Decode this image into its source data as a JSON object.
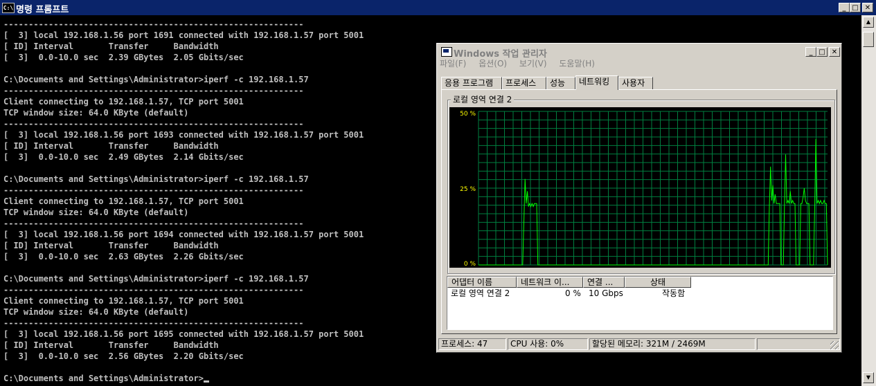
{
  "cmd": {
    "title": "명령 프롬프트",
    "icon_label": "C:\\",
    "lines": [
      "------------------------------------------------------------",
      "[  3] local 192.168.1.56 port 1691 connected with 192.168.1.57 port 5001",
      "[ ID] Interval       Transfer     Bandwidth",
      "[  3]  0.0-10.0 sec  2.39 GBytes  2.05 Gbits/sec",
      "",
      "C:\\Documents and Settings\\Administrator>iperf -c 192.168.1.57",
      "------------------------------------------------------------",
      "Client connecting to 192.168.1.57, TCP port 5001",
      "TCP window size: 64.0 KByte (default)",
      "------------------------------------------------------------",
      "[  3] local 192.168.1.56 port 1693 connected with 192.168.1.57 port 5001",
      "[ ID] Interval       Transfer     Bandwidth",
      "[  3]  0.0-10.0 sec  2.49 GBytes  2.14 Gbits/sec",
      "",
      "C:\\Documents and Settings\\Administrator>iperf -c 192.168.1.57",
      "------------------------------------------------------------",
      "Client connecting to 192.168.1.57, TCP port 5001",
      "TCP window size: 64.0 KByte (default)",
      "------------------------------------------------------------",
      "[  3] local 192.168.1.56 port 1694 connected with 192.168.1.57 port 5001",
      "[ ID] Interval       Transfer     Bandwidth",
      "[  3]  0.0-10.0 sec  2.63 GBytes  2.26 Gbits/sec",
      "",
      "C:\\Documents and Settings\\Administrator>iperf -c 192.168.1.57",
      "------------------------------------------------------------",
      "Client connecting to 192.168.1.57, TCP port 5001",
      "TCP window size: 64.0 KByte (default)",
      "------------------------------------------------------------",
      "[  3] local 192.168.1.56 port 1695 connected with 192.168.1.57 port 5001",
      "[ ID] Interval       Transfer     Bandwidth",
      "[  3]  0.0-10.0 sec  2.56 GBytes  2.20 Gbits/sec",
      "",
      "C:\\Documents and Settings\\Administrator>"
    ]
  },
  "taskmgr": {
    "title": "Windows 작업 관리자",
    "menu": [
      "파일(F)",
      "옵션(O)",
      "보기(V)",
      "도움말(H)"
    ],
    "tabs": [
      "응용 프로그램",
      "프로세스",
      "성능",
      "네트워킹",
      "사용자"
    ],
    "active_tab": "네트워킹",
    "graph_title": "로컬 영역 연결 2",
    "adapter_columns": [
      "어댑터 이름",
      "네트워크 이...",
      "연결 ...",
      "상태"
    ],
    "adapter_rows": [
      [
        "로컬 영역 연결 2",
        "0 %",
        "10 Gbps",
        "작동함"
      ]
    ],
    "status": {
      "processes": "프로세스: 47",
      "cpu": "CPU 사용: 0%",
      "memory": "할당된 메모리: 321M / 2469M"
    }
  },
  "chart_data": {
    "type": "line",
    "y_ticks": [
      "50 %",
      "25 %",
      "0 %"
    ],
    "ylim": [
      0,
      50
    ],
    "grid": true,
    "series": [
      {
        "color": "#00ff00",
        "values": [
          0,
          0,
          0,
          0,
          0,
          0,
          0,
          0,
          0,
          0,
          0,
          0,
          0,
          0,
          0,
          0,
          0,
          0,
          0,
          0,
          0,
          0,
          0,
          0,
          0,
          0,
          0,
          0,
          0,
          0,
          0,
          0,
          0,
          0,
          0,
          0,
          0,
          0,
          0,
          14,
          28,
          20,
          24,
          19,
          20,
          19,
          20,
          19,
          20,
          20,
          20,
          0,
          0,
          0,
          0,
          0,
          0,
          0,
          0,
          0,
          0,
          0,
          0,
          0,
          0,
          0,
          0,
          0,
          0,
          0,
          0,
          0,
          0,
          0,
          0,
          0,
          0,
          0,
          0,
          0,
          0,
          0,
          0,
          0,
          0,
          0,
          0,
          0,
          0,
          0,
          0,
          0,
          0,
          0,
          0,
          0,
          0,
          0,
          0,
          0,
          0,
          0,
          0,
          0,
          0,
          0,
          0,
          0,
          0,
          0,
          0,
          0,
          0,
          0,
          0,
          0,
          0,
          0,
          0,
          0,
          0,
          0,
          0,
          0,
          0,
          0,
          0,
          0,
          0,
          0,
          0,
          0,
          0,
          0,
          0,
          0,
          0,
          0,
          0,
          0,
          0,
          0,
          0,
          0,
          0,
          0,
          0,
          0,
          0,
          0,
          0,
          0,
          0,
          0,
          0,
          0,
          0,
          0,
          0,
          0,
          0,
          0,
          0,
          0,
          0,
          0,
          0,
          0,
          0,
          0,
          0,
          0,
          0,
          0,
          0,
          0,
          0,
          0,
          0,
          0,
          0,
          0,
          0,
          0,
          0,
          0,
          0,
          0,
          0,
          0,
          0,
          0,
          0,
          0,
          0,
          0,
          0,
          0,
          0,
          0,
          0,
          0,
          0,
          0,
          0,
          0,
          0,
          0,
          0,
          0,
          0,
          0,
          0,
          0,
          0,
          0,
          0,
          0,
          0,
          0,
          0,
          0,
          0,
          0,
          0,
          0,
          0,
          0,
          0,
          0,
          0,
          0,
          0,
          0,
          0,
          0,
          0,
          0,
          0,
          0,
          0,
          0,
          0,
          0,
          0,
          0,
          0,
          0,
          0,
          0,
          19,
          32,
          21,
          26,
          20,
          23,
          20,
          20,
          20,
          20,
          0,
          0,
          0,
          19,
          36,
          20,
          21,
          20,
          24,
          20,
          21,
          20,
          20,
          0,
          0,
          0,
          0,
          20,
          20,
          22,
          25,
          21,
          20,
          20,
          20,
          0,
          0,
          0,
          0,
          19,
          41,
          20,
          21,
          20,
          21,
          20,
          20,
          21,
          20,
          20,
          0
        ]
      }
    ]
  }
}
